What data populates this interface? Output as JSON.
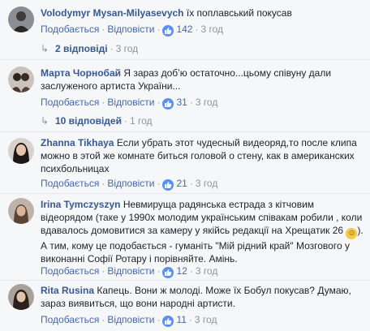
{
  "comments": [
    {
      "author": "Volodymyr Mysan-Milyasevych",
      "text": "їх поплавський покусав",
      "like_label": "Подобається",
      "reply_label": "Відповісти",
      "likes": "142",
      "time": "3 год",
      "replies_label": "2 відповіді",
      "replies_time": "3 год"
    },
    {
      "author": "Марта Чорнобай",
      "text": "Я зараз добʼю остаточно...цьому співуну дали заслуженого артиста України...",
      "like_label": "Подобається",
      "reply_label": "Відповісти",
      "likes": "31",
      "time": "3 год",
      "replies_label": "10 відповідей",
      "replies_time": "1 год"
    },
    {
      "author": "Zhanna Tikhaya",
      "text": "Если убрать этот чудесный видеоряд,то после клипа можно в этой же комнате биться головой о стену, как в американских психбольницах",
      "like_label": "Подобається",
      "reply_label": "Відповісти",
      "likes": "21",
      "time": "3 год"
    },
    {
      "author": "Irina Tymczyszyn",
      "text_before_emoji": "Невмируща радянська естрада з кітчовим відеорядом (таке у 1990х молодим українським співакам робили , коли вдавалось домовитися за камеру у якійсь редакції на Хрещатик 26",
      "emoji": "smile-emoji",
      "text_after_emoji": "). А тим, кому це подобається - гуманіть \"Мій рідний край\" Мозгового у виконанні Софії Ротару і порівняйте. Амінь.",
      "like_label": "Подобається",
      "reply_label": "Відповісти",
      "likes": "12",
      "time": "3 год"
    },
    {
      "author": "Rita Rusina",
      "text": "Капець. Вони ж молоді. Може їх Бобул покусав? Думаю, зараз виявиться, що вони народні артисти.",
      "like_label": "Подобається",
      "reply_label": "Відповісти",
      "likes": "11",
      "time": "3 год"
    }
  ],
  "icons": {
    "like": "thumbs-up-icon",
    "reply_arrow": "reply-arrow-icon"
  },
  "colors": {
    "author": "#365899",
    "link": "#4267b2",
    "meta": "#90949c",
    "like_badge": "#5890ff"
  }
}
